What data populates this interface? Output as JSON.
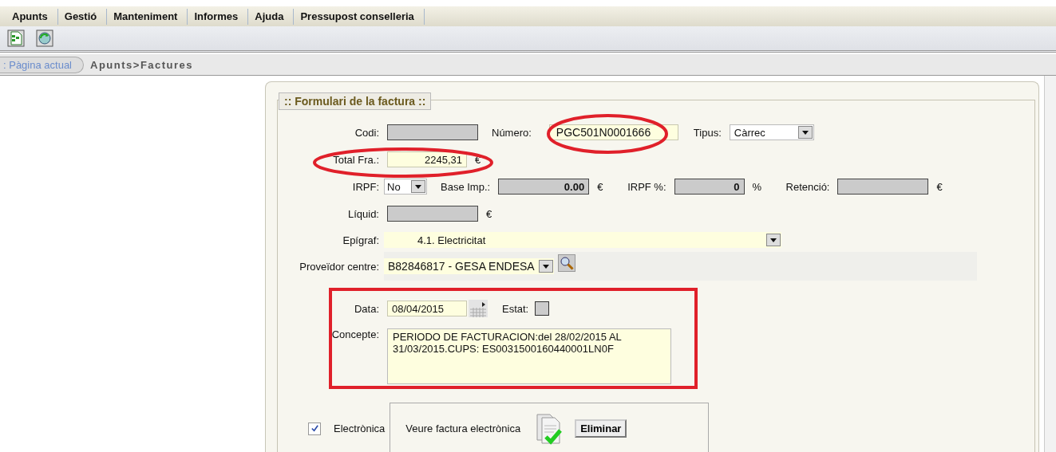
{
  "menu": [
    "Apunts",
    "Gestió",
    "Manteniment",
    "Informes",
    "Ajuda",
    "Pressupost conselleria"
  ],
  "breadcrumb": {
    "current_label": ": Pàgina actual",
    "path": "Apunts>Factures"
  },
  "form": {
    "title": ":: Formulari de la factura ::",
    "codi": {
      "label": "Codi:"
    },
    "numero": {
      "label": "Número:",
      "value": "PGC501N0001666"
    },
    "tipus": {
      "label": "Tipus:",
      "value": "Càrrec"
    },
    "total": {
      "label": "Total Fra.:",
      "value": "2245,31",
      "unit": "€"
    },
    "irpf": {
      "label": "IRPF:",
      "value": "No"
    },
    "base": {
      "label": "Base Imp.:",
      "value": "0.00",
      "unit": "€"
    },
    "irpf_pct": {
      "label": "IRPF %:",
      "value": "0",
      "unit": "%"
    },
    "retencio": {
      "label": "Retenció:",
      "unit": "€"
    },
    "liquid": {
      "label": "Líquid:",
      "unit": "€"
    },
    "epigraf": {
      "label": "Epígraf:",
      "value": "4.1. Electricitat"
    },
    "proveidor": {
      "label": "Proveïdor centre:",
      "value": "B82846817 - GESA ENDESA"
    },
    "data": {
      "label": "Data:",
      "value": "08/04/2015"
    },
    "estat": {
      "label": "Estat:",
      "checked": false
    },
    "concepte": {
      "label": "Concepte:",
      "value": "PERIODO DE FACTURACION:del 28/02/2015 AL 31/03/2015.CUPS: ES0031500160440001LN0F"
    },
    "electronica": {
      "label": "Electrònica",
      "checked": true,
      "link": "Veure factura electrònica",
      "button": "Eliminar"
    }
  }
}
